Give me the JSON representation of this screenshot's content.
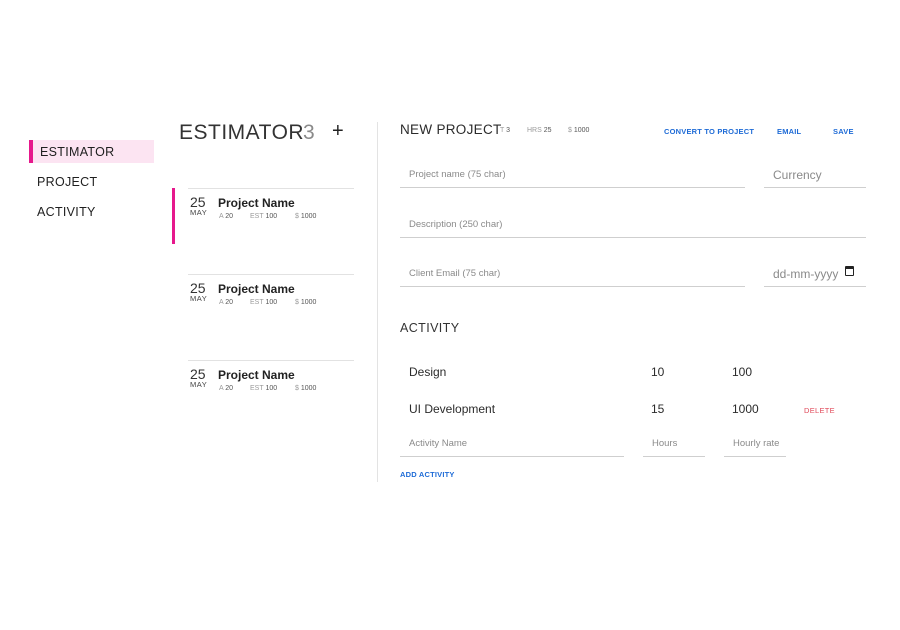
{
  "sidebar": {
    "items": [
      {
        "label": "ESTIMATOR"
      },
      {
        "label": "PROJECT"
      },
      {
        "label": "ACTIVITY"
      }
    ]
  },
  "list": {
    "title": "ESTIMATOR",
    "count": "3",
    "add_label": "+",
    "projects": [
      {
        "day": "25",
        "month": "MAY",
        "name": "Project Name",
        "a_label": "A",
        "a_value": "20",
        "est_label": "EST",
        "est_value": "100",
        "cost_label": "$",
        "cost_value": "1000"
      },
      {
        "day": "25",
        "month": "MAY",
        "name": "Project Name",
        "a_label": "A",
        "a_value": "20",
        "est_label": "EST",
        "est_value": "100",
        "cost_label": "$",
        "cost_value": "1000"
      },
      {
        "day": "25",
        "month": "MAY",
        "name": "Project Name",
        "a_label": "A",
        "a_value": "20",
        "est_label": "EST",
        "est_value": "100",
        "cost_label": "$",
        "cost_value": "1000"
      }
    ]
  },
  "form": {
    "title": "NEW PROJECT",
    "stats": {
      "t_label": "T",
      "t_value": "3",
      "hrs_label": "HRS",
      "hrs_value": "25",
      "cost_label": "$",
      "cost_value": "1000"
    },
    "actions": {
      "convert": "CONVERT TO PROJECT",
      "email": "EMAIL",
      "save": "SAVE"
    },
    "fields": {
      "project_name_placeholder": "Project name (75 char)",
      "currency_placeholder": "Currency",
      "description_placeholder": "Description (250 char)",
      "client_email_placeholder": "Client Email (75 char)",
      "date_placeholder": "dd-mm-yyyy"
    },
    "activity_title": "ACTIVITY",
    "activities": [
      {
        "name": "Design",
        "hours": "10",
        "rate": "100"
      },
      {
        "name": "UI Development",
        "hours": "15",
        "rate": "1000",
        "delete_label": "DELETE"
      }
    ],
    "new_activity": {
      "name_placeholder": "Activity Name",
      "hours_placeholder": "Hours",
      "rate_placeholder": "Hourly rate"
    },
    "add_activity_label": "ADD ACTIVITY"
  },
  "colors": {
    "accent": "#e6188c",
    "accent_bg": "#fce4f2",
    "link": "#1e6bd6",
    "danger": "#e04a5a"
  },
  "icons": {
    "date_picker": "calendar-icon"
  }
}
